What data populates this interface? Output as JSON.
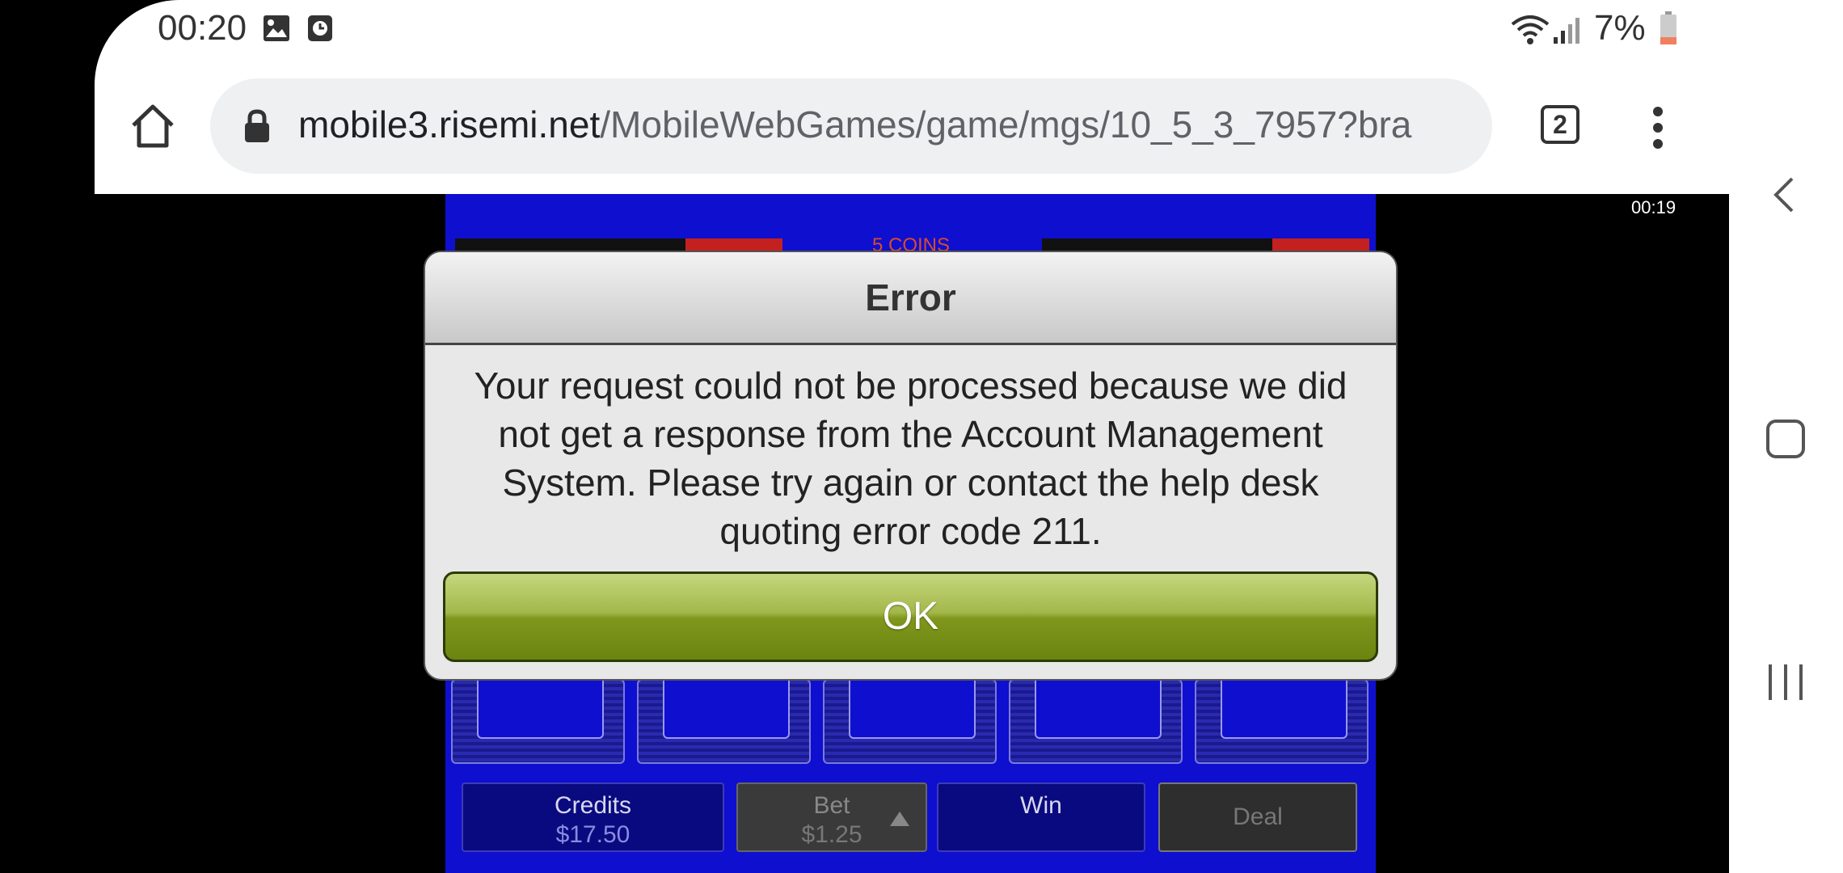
{
  "status_bar": {
    "time": "00:20",
    "battery_percent": "7%",
    "icons": [
      "image-icon",
      "clock-icon",
      "wifi-icon",
      "signal-icon",
      "battery-icon"
    ]
  },
  "browser": {
    "url_host": "mobile3.risemi.net",
    "url_path": "/MobileWebGames/game/mgs/10_5_3_7957?bra",
    "tab_count": "2",
    "icons": [
      "home-icon",
      "lock-icon",
      "tabs-icon",
      "menu-icon"
    ]
  },
  "video_timestamp": "00:19",
  "game": {
    "coins_label": "5 COINS",
    "credits_label": "Credits",
    "credits_value": "$17.50",
    "bet_label": "Bet",
    "bet_value": "$1.25",
    "win_label": "Win",
    "deal_label": "Deal",
    "colors": {
      "background": "#0f0fd0",
      "ok_green": "#7f971c"
    }
  },
  "dialog": {
    "title": "Error",
    "message": "Your request could not be processed because we did not get a response from the Account Management System. Please try again or contact the help desk quoting error code 211.",
    "ok_label": "OK"
  },
  "nav_bar": {
    "icons": [
      "back-icon",
      "home-square-icon",
      "recents-icon"
    ]
  }
}
